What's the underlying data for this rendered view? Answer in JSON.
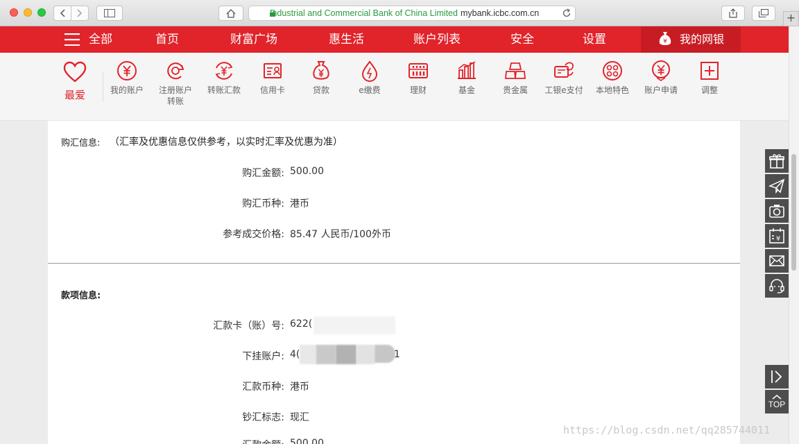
{
  "browser": {
    "url_org": "Industrial and Commercial Bank of China Limited",
    "url_domain": "mybank.icbc.com.cn"
  },
  "nav": {
    "all": "全部",
    "items": [
      "首页",
      "财富广场",
      "惠生活",
      "账户列表",
      "安全",
      "设置"
    ],
    "mine": "我的网银"
  },
  "quick": {
    "favorite": "最爱",
    "items": [
      {
        "label": "我的账户",
        "icon": "yen-circle-icon"
      },
      {
        "label": "注册账户转账",
        "icon": "transfer-icon"
      },
      {
        "label": "转账汇款",
        "icon": "exchange-yen-icon"
      },
      {
        "label": "信用卡",
        "icon": "credit-card-icon"
      },
      {
        "label": "贷款",
        "icon": "money-bag-icon"
      },
      {
        "label": "e缴费",
        "icon": "drop-icon"
      },
      {
        "label": "理财",
        "icon": "abacus-icon"
      },
      {
        "label": "基金",
        "icon": "bar-chart-icon"
      },
      {
        "label": "贵金属",
        "icon": "gold-bars-icon"
      },
      {
        "label": "工银e支付",
        "icon": "epay-icon"
      },
      {
        "label": "本地特色",
        "icon": "local-icon"
      },
      {
        "label": "账户申请",
        "icon": "apply-icon"
      },
      {
        "label": "调整",
        "icon": "plus-square-icon"
      }
    ]
  },
  "purchase": {
    "title": "购汇信息:",
    "note": "（汇率及优惠信息仅供参考，以实时汇率及优惠为准）",
    "rows": [
      {
        "label": "购汇金额:",
        "value": "500.00"
      },
      {
        "label": "购汇币种:",
        "value": "港币"
      },
      {
        "label": "参考成交价格:",
        "value": "85.47 人民币/100外币"
      }
    ]
  },
  "payment": {
    "title": "款项信息:",
    "rows": [
      {
        "label": "汇款卡（账）号:",
        "value": "622("
      },
      {
        "label": "下挂账户:",
        "value": "4(",
        "value_end": "1"
      },
      {
        "label": "汇款币种:",
        "value": "港币"
      },
      {
        "label": "钞汇标志:",
        "value": "现汇"
      },
      {
        "label": "汇款金额:",
        "value": "500.00"
      }
    ]
  },
  "tools": {
    "top_label": "TOP",
    "icons": [
      "gift-icon",
      "paper-plane-icon",
      "camera-icon",
      "calendar-yen-icon",
      "mail-icon",
      "headset-icon",
      "collapse-icon"
    ]
  },
  "watermark": "https://blog.csdn.net/qq285744011",
  "colors": {
    "brand_red": "#e1232a",
    "dark_red": "#c81c24",
    "tool_bg": "#4d4d4d"
  }
}
